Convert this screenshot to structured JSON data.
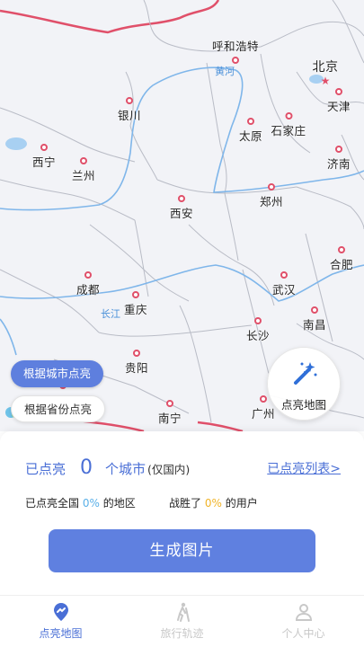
{
  "map": {
    "cities": [
      {
        "name": "呼和浩特",
        "id": "hohhot"
      },
      {
        "name": "北京",
        "id": "beijing",
        "capital": true
      },
      {
        "name": "天津",
        "id": "tianjin"
      },
      {
        "name": "银川",
        "id": "yinchuan"
      },
      {
        "name": "太原",
        "id": "taiyuan"
      },
      {
        "name": "石家庄",
        "id": "shijiazhuang"
      },
      {
        "name": "西宁",
        "id": "xining"
      },
      {
        "name": "兰州",
        "id": "lanzhou"
      },
      {
        "name": "济南",
        "id": "jinan"
      },
      {
        "name": "郑州",
        "id": "zhengzhou"
      },
      {
        "name": "西安",
        "id": "xian"
      },
      {
        "name": "合肥",
        "id": "hefei"
      },
      {
        "name": "成都",
        "id": "chengdu"
      },
      {
        "name": "武汉",
        "id": "wuhan"
      },
      {
        "name": "重庆",
        "id": "chongqing"
      },
      {
        "name": "南昌",
        "id": "nanchang"
      },
      {
        "name": "长沙",
        "id": "changsha"
      },
      {
        "name": "贵阳",
        "id": "guiyang"
      },
      {
        "name": "南宁",
        "id": "nanning"
      },
      {
        "name": "广州",
        "id": "guangzhou"
      }
    ],
    "rivers": {
      "yellow": "黄河",
      "yangtze": "长江"
    }
  },
  "controls": {
    "by_city": "根据城市点亮",
    "by_province": "根据省份点亮",
    "light_map": "点亮地图"
  },
  "stats": {
    "lit_prefix": "已点亮",
    "lit_count": "0",
    "lit_suffix": "个城市",
    "scope": "(仅国内)",
    "list_link": "已点亮列表>",
    "national_prefix": "已点亮全国",
    "national_pct": "0%",
    "national_suffix": "的地区",
    "beat_prefix": "战胜了",
    "beat_pct": "0%",
    "beat_suffix": "的用户"
  },
  "generate_button": "生成图片",
  "tabs": [
    {
      "label": "点亮地图",
      "active": true
    },
    {
      "label": "旅行轨迹",
      "active": false
    },
    {
      "label": "个人中心",
      "active": false
    }
  ],
  "colors": {
    "accent": "#5f80e0",
    "city_marker": "#e0506a",
    "river": "#4a90d9",
    "border": "#e0506a"
  }
}
